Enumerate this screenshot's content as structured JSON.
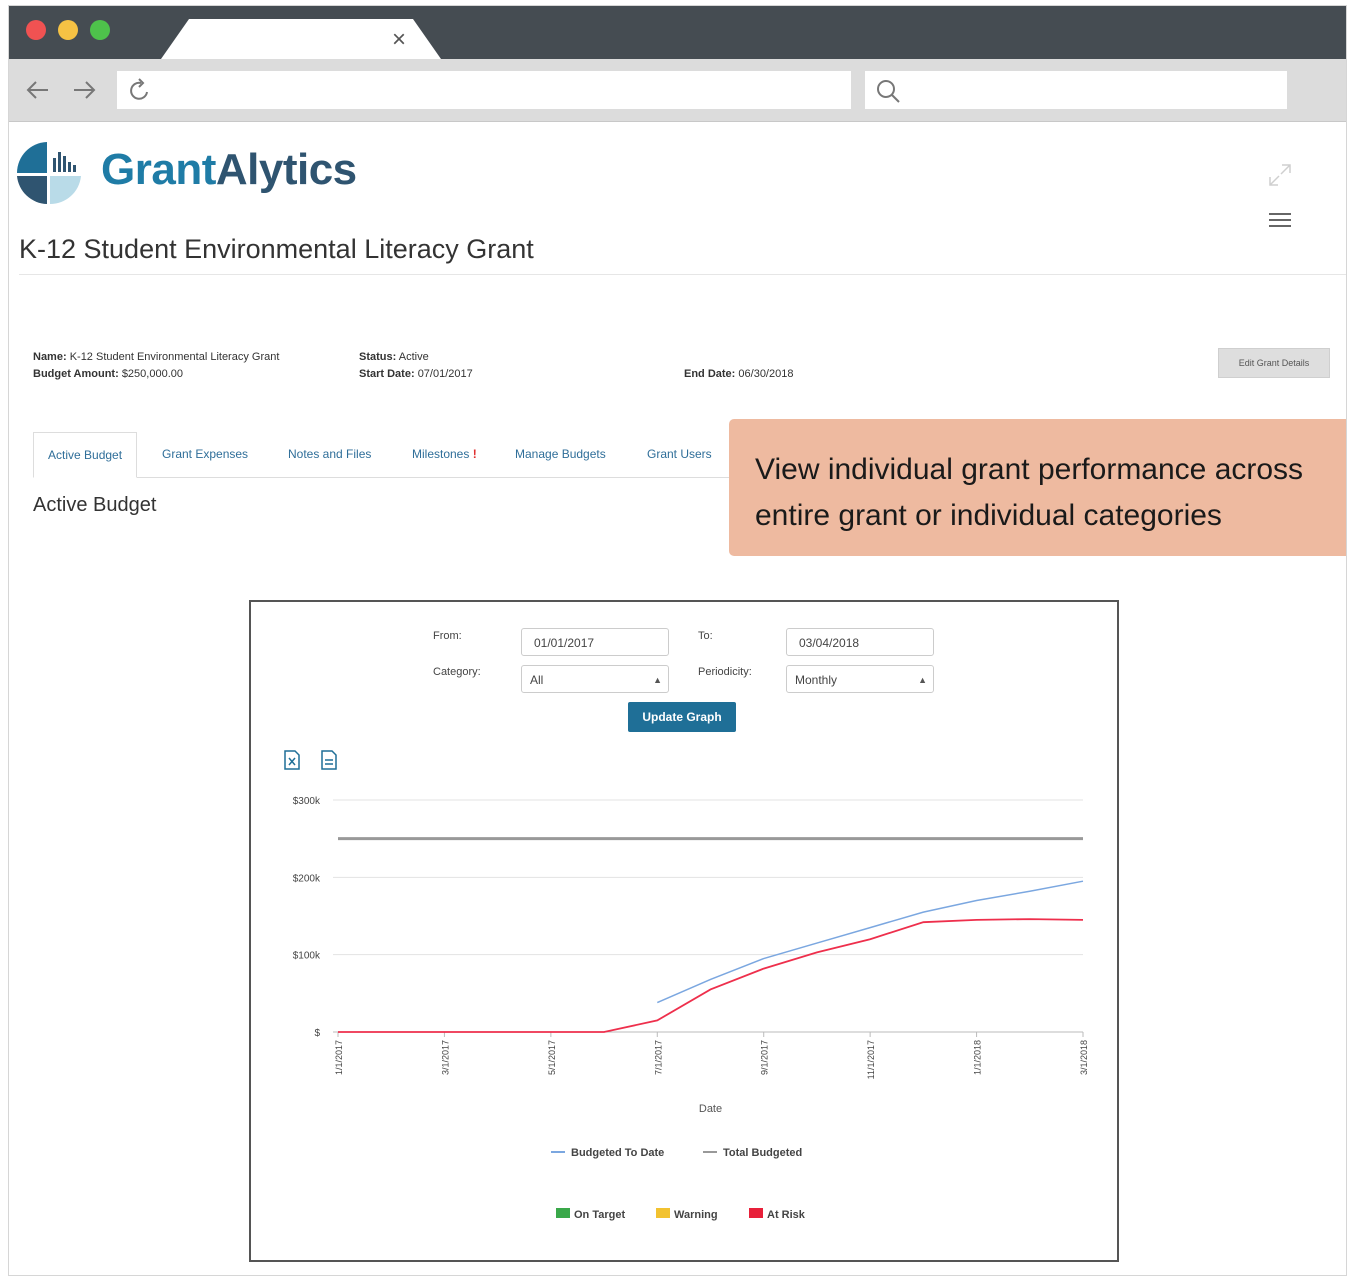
{
  "browser": {
    "tab_close_glyph": "×",
    "url_value": "",
    "search_value": ""
  },
  "app": {
    "logo_part1": "Grant",
    "logo_part2": "Alytics",
    "grant_title": "K-12 Student Environmental Literacy Grant"
  },
  "grant_info": {
    "name_label": "Name:",
    "name_value": "K-12 Student Environmental Literacy Grant",
    "budget_label": "Budget Amount:",
    "budget_value": "$250,000.00",
    "status_label": "Status:",
    "status_value": "Active",
    "start_label": "Start Date:",
    "start_value": "07/01/2017",
    "end_label": "End Date:",
    "end_value": "06/30/2018",
    "edit_button": "Edit Grant Details"
  },
  "tabs": [
    {
      "label": "Active Budget"
    },
    {
      "label": "Grant Expenses"
    },
    {
      "label": "Notes and Files"
    },
    {
      "label": "Milestones",
      "badge": "!"
    },
    {
      "label": "Manage Budgets"
    },
    {
      "label": "Grant Users"
    }
  ],
  "section_title": "Active Budget",
  "callout": {
    "line1": "View individual grant performance across",
    "line2": "entire grant or individual categories"
  },
  "filters": {
    "from_label": "From:",
    "from_value": "01/01/2017",
    "to_label": "To:",
    "to_value": "03/04/2018",
    "category_label": "Category:",
    "category_value": "All",
    "periodicity_label": "Periodicity:",
    "periodicity_value": "Monthly",
    "update_button": "Update Graph"
  },
  "colors": {
    "accent": "#1f6f97",
    "callout": "#eebaa0",
    "budgeted_to_date": "#7ba7e0",
    "total_budgeted": "#999999",
    "actual": "#ee2f4c",
    "on_target": "#3aa84a",
    "warning": "#f2c230",
    "at_risk": "#e8203a"
  },
  "chart_data": {
    "type": "line",
    "xlabel": "Date",
    "ylabel": "",
    "x": [
      "1/1/2017",
      "2/1/2017",
      "3/1/2017",
      "4/1/2017",
      "5/1/2017",
      "6/1/2017",
      "7/1/2017",
      "8/1/2017",
      "9/1/2017",
      "10/1/2017",
      "11/1/2017",
      "12/1/2017",
      "1/1/2018",
      "2/1/2018",
      "3/1/2018"
    ],
    "x_tick_labels": [
      "1/1/2017",
      "3/1/2017",
      "5/1/2017",
      "7/1/2017",
      "9/1/2017",
      "11/1/2017",
      "1/1/2018",
      "3/1/2018"
    ],
    "y_tick_labels": [
      "$",
      "$100k",
      "$200k",
      "$300k"
    ],
    "ylim": [
      0,
      300000
    ],
    "grid": true,
    "series": [
      {
        "name": "Budgeted To Date",
        "values": [
          null,
          null,
          null,
          null,
          null,
          null,
          38000,
          68000,
          95000,
          115000,
          135000,
          155000,
          170000,
          182000,
          195000
        ]
      },
      {
        "name": "Total Budgeted",
        "values": [
          250000,
          250000,
          250000,
          250000,
          250000,
          250000,
          250000,
          250000,
          250000,
          250000,
          250000,
          250000,
          250000,
          250000,
          250000
        ]
      },
      {
        "name": "",
        "values": [
          0,
          0,
          0,
          0,
          0,
          0,
          15000,
          55000,
          82000,
          103000,
          120000,
          142000,
          145000,
          146000,
          145000
        ]
      }
    ],
    "legend": [
      "Budgeted To Date",
      "Total Budgeted"
    ],
    "status_legend": [
      "On Target",
      "Warning",
      "At Risk"
    ]
  }
}
